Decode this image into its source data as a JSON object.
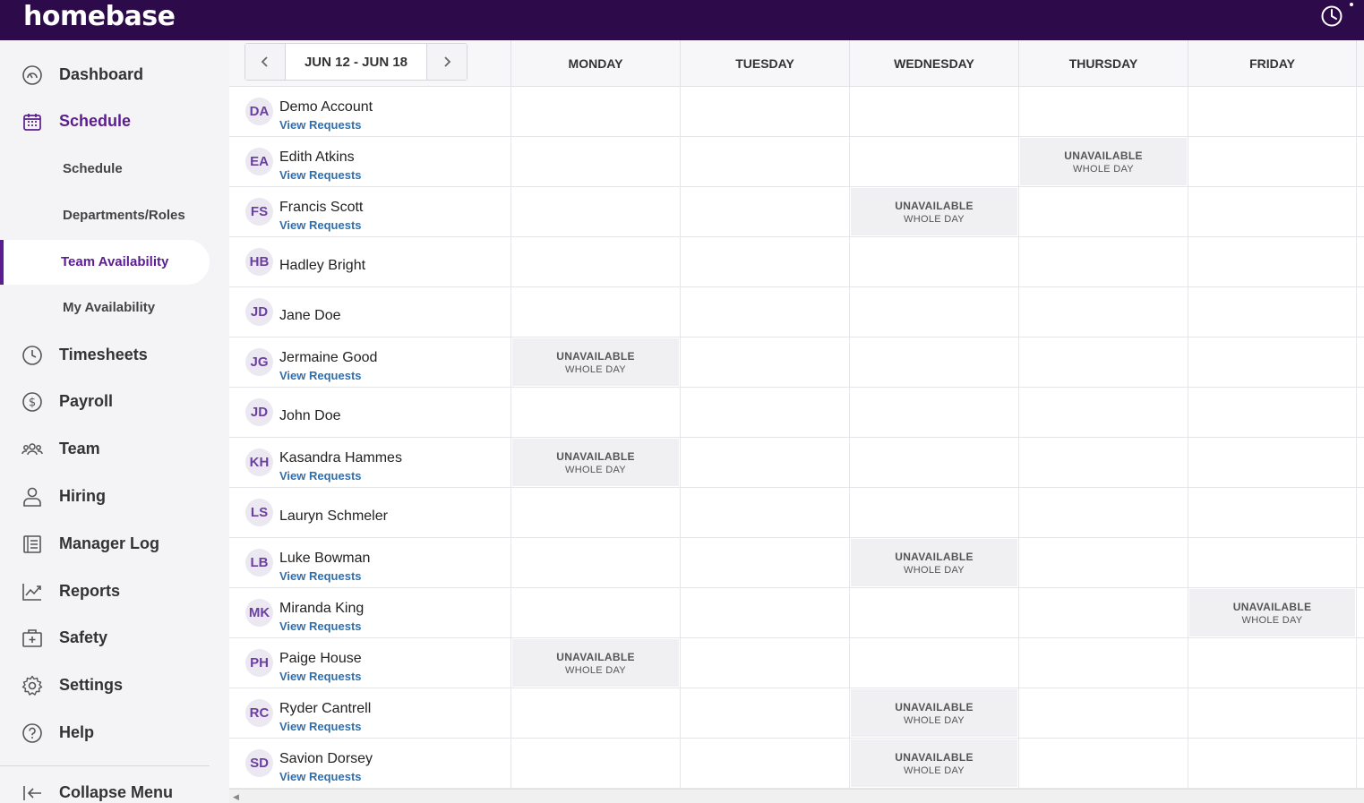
{
  "app": {
    "logo": "homebase"
  },
  "sidebar": {
    "nav": [
      {
        "label": "Dashboard",
        "icon": "dashboard-icon"
      },
      {
        "label": "Schedule",
        "icon": "calendar-icon"
      },
      {
        "label": "Timesheets",
        "icon": "clock-icon"
      },
      {
        "label": "Payroll",
        "icon": "dollar-icon"
      },
      {
        "label": "Team",
        "icon": "team-icon"
      },
      {
        "label": "Hiring",
        "icon": "person-icon"
      },
      {
        "label": "Manager Log",
        "icon": "notebook-icon"
      },
      {
        "label": "Reports",
        "icon": "chart-icon"
      },
      {
        "label": "Safety",
        "icon": "first-aid-icon"
      },
      {
        "label": "Settings",
        "icon": "gear-icon"
      },
      {
        "label": "Help",
        "icon": "help-icon"
      }
    ],
    "sub": [
      "Schedule",
      "Departments/Roles",
      "Team Availability",
      "My Availability"
    ],
    "collapse_label": "Collapse Menu"
  },
  "schedule": {
    "date_range": "JUN 12 - JUN 18",
    "days": [
      "MONDAY",
      "TUESDAY",
      "WEDNESDAY",
      "THURSDAY",
      "FRIDAY"
    ],
    "unavailable_label": "UNAVAILABLE",
    "whole_day_label": "WHOLE DAY",
    "view_requests_label": "View Requests",
    "employees": [
      {
        "initials": "DA",
        "name": "Demo Account",
        "has_requests": true,
        "unavailable": []
      },
      {
        "initials": "EA",
        "name": "Edith Atkins",
        "has_requests": true,
        "unavailable": [
          3
        ]
      },
      {
        "initials": "FS",
        "name": "Francis Scott",
        "has_requests": true,
        "unavailable": [
          2
        ]
      },
      {
        "initials": "HB",
        "name": "Hadley Bright",
        "has_requests": false,
        "unavailable": []
      },
      {
        "initials": "JD",
        "name": "Jane Doe",
        "has_requests": false,
        "unavailable": []
      },
      {
        "initials": "JG",
        "name": "Jermaine Good",
        "has_requests": true,
        "unavailable": [
          0
        ]
      },
      {
        "initials": "JD",
        "name": "John Doe",
        "has_requests": false,
        "unavailable": []
      },
      {
        "initials": "KH",
        "name": "Kasandra Hammes",
        "has_requests": true,
        "unavailable": [
          0
        ]
      },
      {
        "initials": "LS",
        "name": "Lauryn Schmeler",
        "has_requests": false,
        "unavailable": []
      },
      {
        "initials": "LB",
        "name": "Luke Bowman",
        "has_requests": true,
        "unavailable": [
          2
        ]
      },
      {
        "initials": "MK",
        "name": "Miranda King",
        "has_requests": true,
        "unavailable": [
          4
        ]
      },
      {
        "initials": "PH",
        "name": "Paige House",
        "has_requests": true,
        "unavailable": [
          0
        ]
      },
      {
        "initials": "RC",
        "name": "Ryder Cantrell",
        "has_requests": true,
        "unavailable": [
          2
        ]
      },
      {
        "initials": "SD",
        "name": "Savion Dorsey",
        "has_requests": true,
        "unavailable": [
          2
        ]
      }
    ]
  },
  "colors": {
    "brand": "#2d0a4a",
    "accent": "#5b1d8f",
    "link": "#2f6fb0"
  }
}
